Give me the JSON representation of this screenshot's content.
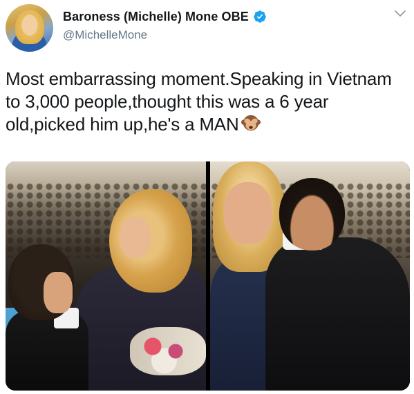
{
  "tweet": {
    "display_name": "Baroness (Michelle) Mone OBE",
    "handle": "@MichelleMone",
    "text": "Most embarrassing moment.Speaking in Vietnam to 3,000 people,thought this was a 6 year old,picked him up,he's a MAN",
    "emoji": "see-no-evil-monkey-icon",
    "verified": true
  },
  "icons": {
    "verified": "verified-badge-icon",
    "menu": "chevron-down-icon"
  },
  "colors": {
    "verified_blue": "#1da1f2",
    "handle_gray": "#657786",
    "text": "#14171a"
  }
}
